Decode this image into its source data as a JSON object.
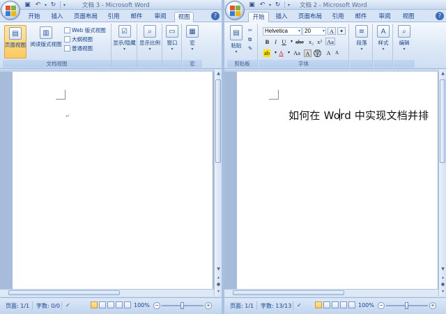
{
  "left": {
    "title": "文档 3 - Microsoft Word",
    "tabs": [
      "开始",
      "插入",
      "页面布局",
      "引用",
      "邮件",
      "审阅",
      "视图"
    ],
    "active_tab": "视图",
    "ribbon": {
      "print_layout": "页面视图",
      "full_reading": "阅读版式视图",
      "web_layout": "Web 版式视图",
      "outline": "大纲视图",
      "draft": "普通视图",
      "views_group": "文档视图",
      "show_hide": "显示/隐藏",
      "zoom": "显示比例",
      "window": "窗口",
      "macros": "宏",
      "macros_group": "宏"
    },
    "paragraph_mark": "↵",
    "status": {
      "page": "页面: 1/1",
      "words": "字数: 0/0",
      "zoom": "100%"
    }
  },
  "right": {
    "title": "文档 2 - Microsoft Word",
    "tabs": [
      "开始",
      "插入",
      "页面布局",
      "引用",
      "邮件",
      "审阅",
      "视图"
    ],
    "active_tab": "开始",
    "ribbon": {
      "paste": "粘贴",
      "clipboard_group": "剪贴板",
      "font_name": "Helvetica",
      "font_size": "20",
      "font_group": "字体",
      "paragraph": "段落",
      "styles": "样式",
      "editing": "编辑"
    },
    "doc_text": "如何在 Word 中实现文档并排",
    "status": {
      "page": "页面: 1/1",
      "words": "字数: 13/13",
      "zoom": "100%"
    }
  }
}
